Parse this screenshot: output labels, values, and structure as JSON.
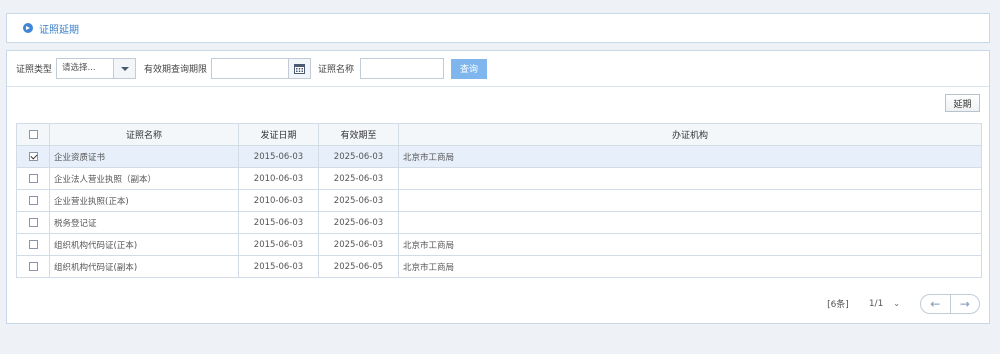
{
  "header": {
    "title": "证照延期"
  },
  "filters": {
    "type_label": "证照类型",
    "type_select_value": "请选择...",
    "period_label": "有效期查询期限",
    "name_label": "证照名称",
    "query_button": "查询"
  },
  "toolbar": {
    "extend_button": "延期"
  },
  "table": {
    "columns": [
      "证照名称",
      "发证日期",
      "有效期至",
      "办证机构"
    ],
    "rows": [
      {
        "name": "企业资质证书",
        "issued": "2015-06-03",
        "valid_until": "2025-06-03",
        "agency": "北京市工商局",
        "checked": true
      },
      {
        "name": "企业法人营业执照（副本）",
        "issued": "2010-06-03",
        "valid_until": "2025-06-03",
        "agency": "",
        "checked": false
      },
      {
        "name": "企业营业执照(正本)",
        "issued": "2010-06-03",
        "valid_until": "2025-06-03",
        "agency": "",
        "checked": false
      },
      {
        "name": "税务登记证",
        "issued": "2015-06-03",
        "valid_until": "2025-06-03",
        "agency": "",
        "checked": false
      },
      {
        "name": "组织机构代码证(正本)",
        "issued": "2015-06-03",
        "valid_until": "2025-06-03",
        "agency": "北京市工商局",
        "checked": false
      },
      {
        "name": "组织机构代码证(副本)",
        "issued": "2015-06-03",
        "valid_until": "2025-06-05",
        "agency": "北京市工商局",
        "checked": false
      }
    ]
  },
  "pager": {
    "count": "[6条]",
    "pages": "1/1",
    "chevron": "⌄",
    "prev": "←",
    "next": "→"
  },
  "icons": {
    "header": "circle-arrow-icon",
    "calendar": "calendar-icon",
    "dropdown": "caret-down-icon"
  },
  "colors": {
    "accent": "#3a7fc9",
    "query_button": "#7fb6ee",
    "selected_row": "#e7f0fa"
  }
}
